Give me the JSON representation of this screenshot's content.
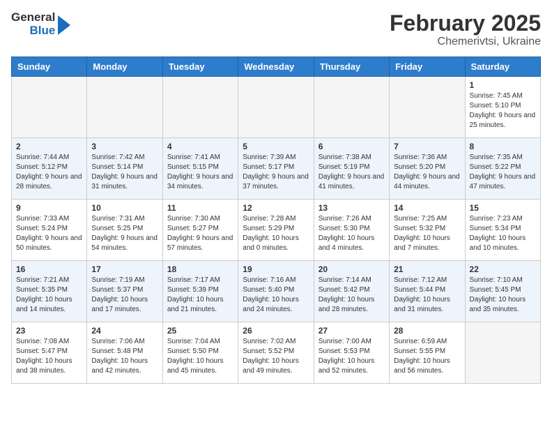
{
  "header": {
    "logo_line1": "General",
    "logo_line2": "Blue",
    "title": "February 2025",
    "subtitle": "Chemerivtsi, Ukraine"
  },
  "weekdays": [
    "Sunday",
    "Monday",
    "Tuesday",
    "Wednesday",
    "Thursday",
    "Friday",
    "Saturday"
  ],
  "weeks": [
    [
      {
        "day": "",
        "info": ""
      },
      {
        "day": "",
        "info": ""
      },
      {
        "day": "",
        "info": ""
      },
      {
        "day": "",
        "info": ""
      },
      {
        "day": "",
        "info": ""
      },
      {
        "day": "",
        "info": ""
      },
      {
        "day": "1",
        "info": "Sunrise: 7:45 AM\nSunset: 5:10 PM\nDaylight: 9 hours and 25 minutes."
      }
    ],
    [
      {
        "day": "2",
        "info": "Sunrise: 7:44 AM\nSunset: 5:12 PM\nDaylight: 9 hours and 28 minutes."
      },
      {
        "day": "3",
        "info": "Sunrise: 7:42 AM\nSunset: 5:14 PM\nDaylight: 9 hours and 31 minutes."
      },
      {
        "day": "4",
        "info": "Sunrise: 7:41 AM\nSunset: 5:15 PM\nDaylight: 9 hours and 34 minutes."
      },
      {
        "day": "5",
        "info": "Sunrise: 7:39 AM\nSunset: 5:17 PM\nDaylight: 9 hours and 37 minutes."
      },
      {
        "day": "6",
        "info": "Sunrise: 7:38 AM\nSunset: 5:19 PM\nDaylight: 9 hours and 41 minutes."
      },
      {
        "day": "7",
        "info": "Sunrise: 7:36 AM\nSunset: 5:20 PM\nDaylight: 9 hours and 44 minutes."
      },
      {
        "day": "8",
        "info": "Sunrise: 7:35 AM\nSunset: 5:22 PM\nDaylight: 9 hours and 47 minutes."
      }
    ],
    [
      {
        "day": "9",
        "info": "Sunrise: 7:33 AM\nSunset: 5:24 PM\nDaylight: 9 hours and 50 minutes."
      },
      {
        "day": "10",
        "info": "Sunrise: 7:31 AM\nSunset: 5:25 PM\nDaylight: 9 hours and 54 minutes."
      },
      {
        "day": "11",
        "info": "Sunrise: 7:30 AM\nSunset: 5:27 PM\nDaylight: 9 hours and 57 minutes."
      },
      {
        "day": "12",
        "info": "Sunrise: 7:28 AM\nSunset: 5:29 PM\nDaylight: 10 hours and 0 minutes."
      },
      {
        "day": "13",
        "info": "Sunrise: 7:26 AM\nSunset: 5:30 PM\nDaylight: 10 hours and 4 minutes."
      },
      {
        "day": "14",
        "info": "Sunrise: 7:25 AM\nSunset: 5:32 PM\nDaylight: 10 hours and 7 minutes."
      },
      {
        "day": "15",
        "info": "Sunrise: 7:23 AM\nSunset: 5:34 PM\nDaylight: 10 hours and 10 minutes."
      }
    ],
    [
      {
        "day": "16",
        "info": "Sunrise: 7:21 AM\nSunset: 5:35 PM\nDaylight: 10 hours and 14 minutes."
      },
      {
        "day": "17",
        "info": "Sunrise: 7:19 AM\nSunset: 5:37 PM\nDaylight: 10 hours and 17 minutes."
      },
      {
        "day": "18",
        "info": "Sunrise: 7:17 AM\nSunset: 5:39 PM\nDaylight: 10 hours and 21 minutes."
      },
      {
        "day": "19",
        "info": "Sunrise: 7:16 AM\nSunset: 5:40 PM\nDaylight: 10 hours and 24 minutes."
      },
      {
        "day": "20",
        "info": "Sunrise: 7:14 AM\nSunset: 5:42 PM\nDaylight: 10 hours and 28 minutes."
      },
      {
        "day": "21",
        "info": "Sunrise: 7:12 AM\nSunset: 5:44 PM\nDaylight: 10 hours and 31 minutes."
      },
      {
        "day": "22",
        "info": "Sunrise: 7:10 AM\nSunset: 5:45 PM\nDaylight: 10 hours and 35 minutes."
      }
    ],
    [
      {
        "day": "23",
        "info": "Sunrise: 7:08 AM\nSunset: 5:47 PM\nDaylight: 10 hours and 38 minutes."
      },
      {
        "day": "24",
        "info": "Sunrise: 7:06 AM\nSunset: 5:48 PM\nDaylight: 10 hours and 42 minutes."
      },
      {
        "day": "25",
        "info": "Sunrise: 7:04 AM\nSunset: 5:50 PM\nDaylight: 10 hours and 45 minutes."
      },
      {
        "day": "26",
        "info": "Sunrise: 7:02 AM\nSunset: 5:52 PM\nDaylight: 10 hours and 49 minutes."
      },
      {
        "day": "27",
        "info": "Sunrise: 7:00 AM\nSunset: 5:53 PM\nDaylight: 10 hours and 52 minutes."
      },
      {
        "day": "28",
        "info": "Sunrise: 6:59 AM\nSunset: 5:55 PM\nDaylight: 10 hours and 56 minutes."
      },
      {
        "day": "",
        "info": ""
      }
    ]
  ]
}
